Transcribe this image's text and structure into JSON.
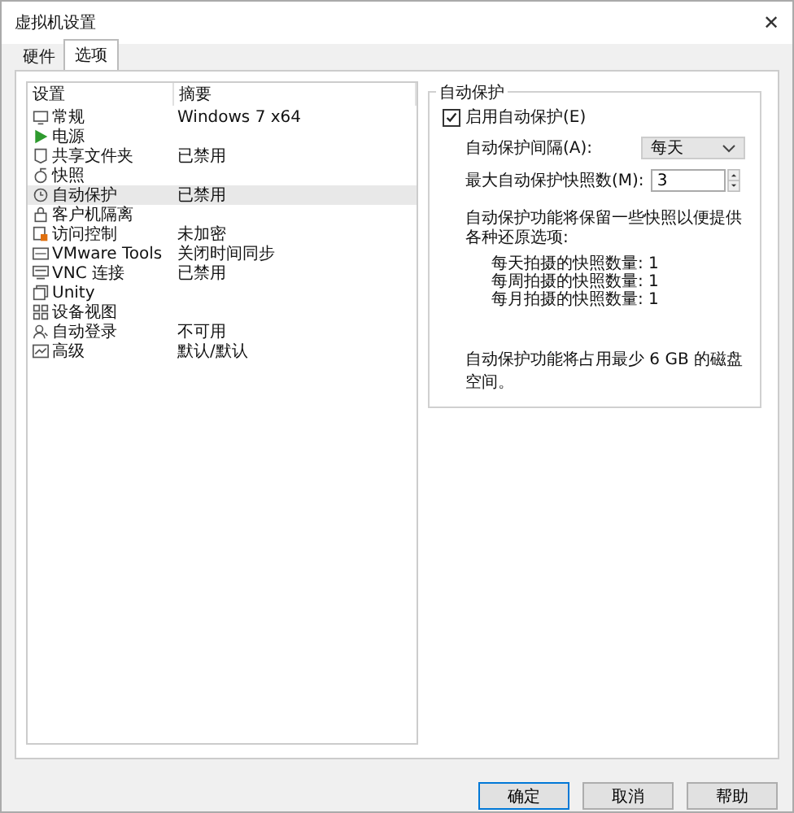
{
  "window": {
    "title": "虚拟机设置",
    "close": "✕"
  },
  "tabs": [
    {
      "label": "硬件",
      "selected": false
    },
    {
      "label": "选项",
      "selected": true
    }
  ],
  "settings_list": {
    "columns": [
      "设置",
      "摘要"
    ],
    "rows": [
      {
        "name": "常规",
        "summary": "Windows 7 x64",
        "selected": false
      },
      {
        "name": "电源",
        "selected": false
      },
      {
        "name": "共享文件夹",
        "summary": "已禁用",
        "selected": false
      },
      {
        "name": "快照",
        "selected": false
      },
      {
        "name": "自动保护",
        "summary": "已禁用",
        "selected": true
      },
      {
        "name": "客户机隔离",
        "selected": false
      },
      {
        "name": "访问控制",
        "summary": "未加密",
        "selected": false
      },
      {
        "name": "VMware Tools",
        "summary": "关闭时间同步",
        "selected": false
      },
      {
        "name": "VNC 连接",
        "summary": "已禁用",
        "selected": false
      },
      {
        "name": "Unity",
        "selected": false
      },
      {
        "name": "设备视图",
        "selected": false
      },
      {
        "name": "自动登录",
        "summary": "不可用",
        "selected": false
      },
      {
        "name": "高级",
        "summary": "默认/默认",
        "selected": false
      }
    ]
  },
  "autoprotect": {
    "title": "自动保护",
    "enable": {
      "label": "启用自动保护(E)",
      "checked": true
    },
    "interval": {
      "label": "自动保护间隔(A):",
      "value": "每天"
    },
    "max_snapshots": {
      "label": "最大自动保护快照数(M):",
      "value": "3"
    },
    "description": "自动保护功能将保留一些快照以便提供各种还原选项:",
    "counts": [
      "每天拍摄的快照数量: 1",
      "每周拍摄的快照数量: 1",
      "每月拍摄的快照数量: 1"
    ],
    "disk_note": "自动保护功能将占用最少 6 GB 的磁盘空间。"
  },
  "buttons": [
    {
      "label": "确定",
      "default": true
    },
    {
      "label": "取消",
      "default": false
    },
    {
      "label": "帮助",
      "default": false
    }
  ]
}
